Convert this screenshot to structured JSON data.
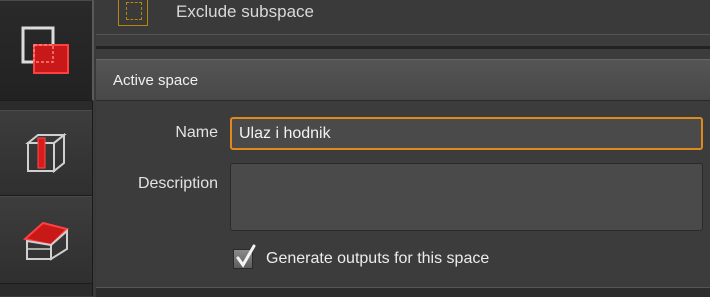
{
  "toolstrip": {
    "items": [
      {
        "icon": "exclude-subspace-icon",
        "active": true
      },
      {
        "icon": "space-box-icon",
        "active": false
      },
      {
        "icon": "roof-box-icon",
        "active": false
      }
    ]
  },
  "top_row": {
    "label": "Exclude subspace"
  },
  "section": {
    "title": "Active space"
  },
  "form": {
    "name_label": "Name",
    "name_value": "Ulaz i hodnik",
    "description_label": "Description",
    "description_value": "",
    "generate_outputs_label": "Generate outputs for this space",
    "generate_outputs_checked": true
  },
  "colors": {
    "accent_orange": "#e08a1e",
    "icon_red": "#e02020"
  }
}
